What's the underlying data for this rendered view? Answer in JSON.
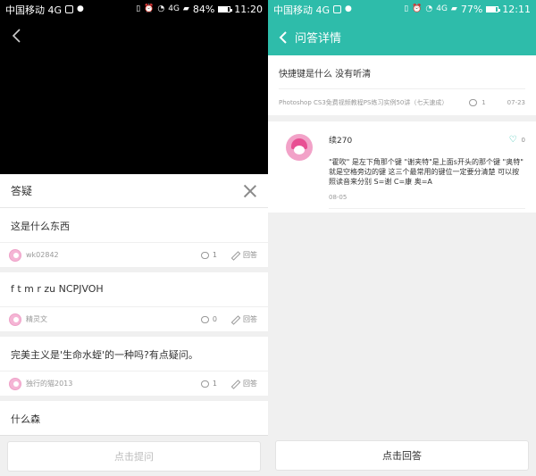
{
  "left": {
    "status": {
      "carrier": "中国移动 4G",
      "net": "4G",
      "battery": "84%",
      "battery_level": 0.84,
      "time": "11:20"
    },
    "qa_title": "答疑",
    "questions": [
      {
        "text": "这是什么东西",
        "author": "wk02842",
        "comments": "1",
        "reply_label": "回答"
      },
      {
        "text": "f t m r zu NCPJVOH",
        "author": "精灵文",
        "comments": "0",
        "reply_label": "回答"
      },
      {
        "text": "完美主义是'生命水蛭'的一种吗?有点疑问。",
        "author": "独行的猫2013",
        "comments": "1",
        "reply_label": "回答"
      },
      {
        "text": "什么森",
        "author": "",
        "comments": "",
        "reply_label": ""
      }
    ],
    "ask_button": "点击提问"
  },
  "right": {
    "status": {
      "carrier": "中国移动 4G",
      "net": "4G",
      "battery": "77%",
      "battery_level": 0.77,
      "time": "12:11"
    },
    "title": "问答详情",
    "question": {
      "text": "快捷键是什么 没有听清",
      "course": "Photoshop CS3免费视频教程PS练习实例50讲（七天速成）",
      "comments": "1",
      "date": "07-23"
    },
    "answer": {
      "author": "续270",
      "likes": "0",
      "text": "\"霍吹\" 是左下角那个键 \"谢夹特\"是上面s开头的那个键 \"奥特\" 就是空格旁边的键 这三个最常用的键位一定要分清楚 可以按照读音来分别 S=谢 C=康 奥=A",
      "date": "08-05"
    },
    "reply_button": "点击回答"
  },
  "colors": {
    "accent": "#2ebcaa",
    "avatar_pink": "#e84f93"
  }
}
